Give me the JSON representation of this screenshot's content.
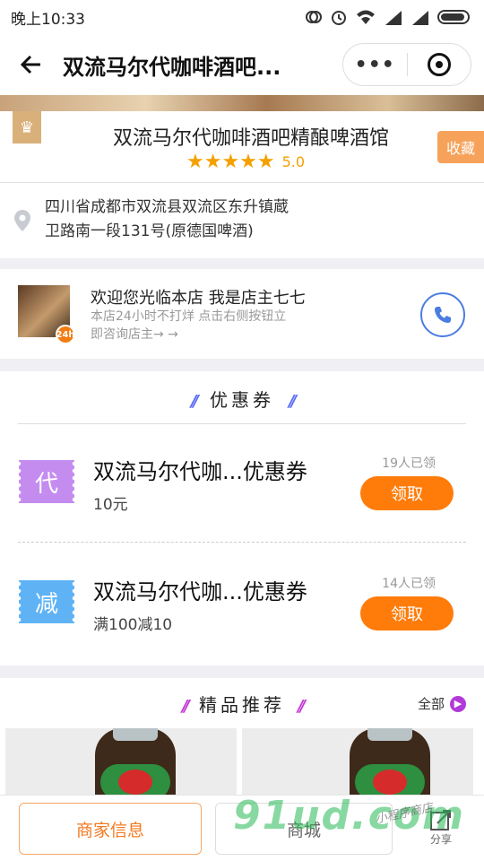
{
  "status_bar": {
    "time": "晚上10:33"
  },
  "nav": {
    "title": "双流马尔代咖啡酒吧..."
  },
  "shop": {
    "name": "双流马尔代咖啡酒吧精酿啤酒馆",
    "stars": "★★★★★",
    "score": "5.0",
    "favorite_label": "收藏"
  },
  "address": {
    "line1": "四川省成都市双流县双流区东升镇蔵",
    "line2": "卫路南一段131号(原德国啤酒)"
  },
  "owner": {
    "welcome": "欢迎您光临本店 我是店主七七",
    "sub_line1": "本店24小时不打烊 点击右侧按钮立",
    "sub_line2": "即咨询店主→ →",
    "badge": "24h"
  },
  "coupons": {
    "title": "优惠券",
    "items": [
      {
        "icon_text": "代",
        "icon_color": "#c58cf0",
        "name": "双流马尔代咖...优惠券",
        "desc": "10元",
        "count": "19人已领",
        "button": "领取"
      },
      {
        "icon_text": "减",
        "icon_color": "#5fb3f5",
        "name": "双流马尔代咖...优惠券",
        "desc": "满100减10",
        "count": "14人已领",
        "button": "领取"
      }
    ]
  },
  "recommend": {
    "title": "精品推荐",
    "all_label": "全部"
  },
  "bottom": {
    "shop_info": "商家信息",
    "mall": "商城",
    "share": "分享"
  },
  "watermark": {
    "main": "91ud.com",
    "small": "小程序商店"
  },
  "colors": {
    "accent": "#ff7c0a",
    "star": "#f4a000",
    "phone": "#4a7de0"
  }
}
